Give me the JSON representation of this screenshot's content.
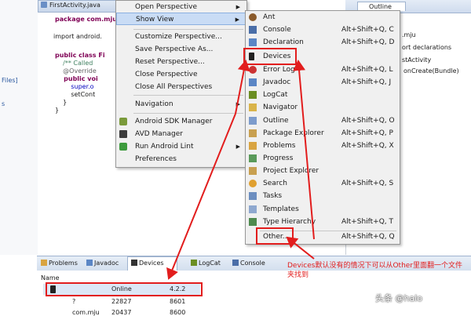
{
  "editor": {
    "tab_label": "FirstActivity.java",
    "code_lines": [
      "package com.mju",
      "import android.",
      "public class Fi",
      "    /** Called",
      "    @Override",
      "    public voi",
      "        super.o",
      "        setCont",
      "    }",
      "}"
    ]
  },
  "left_strip": {
    "labels": [
      "Files]",
      "s"
    ]
  },
  "outline": {
    "tab_label": "Outline",
    "items": [
      ".mju",
      "ort declarations",
      "stActivity",
      "onCreate(Bundle)"
    ]
  },
  "window_menu": {
    "items": [
      {
        "label": "Open Perspective",
        "submenu": true
      },
      {
        "label": "Show View",
        "submenu": true,
        "highlighted": true
      },
      {
        "label": "Customize Perspective..."
      },
      {
        "label": "Save Perspective As..."
      },
      {
        "label": "Reset Perspective..."
      },
      {
        "label": "Close Perspective"
      },
      {
        "label": "Close All Perspectives"
      },
      {
        "label": "Navigation",
        "submenu": true
      },
      {
        "label": "Android SDK Manager"
      },
      {
        "label": "AVD Manager"
      },
      {
        "label": "Run Android Lint",
        "submenu": true
      },
      {
        "label": "Preferences"
      }
    ]
  },
  "show_view_menu": {
    "items": [
      {
        "label": "Ant",
        "shortcut": ""
      },
      {
        "label": "Console",
        "shortcut": "Alt+Shift+Q, C"
      },
      {
        "label": "Declaration",
        "shortcut": "Alt+Shift+Q, D"
      },
      {
        "label": "Devices",
        "shortcut": ""
      },
      {
        "label": "Error Log",
        "shortcut": "Alt+Shift+Q, L"
      },
      {
        "label": "Javadoc",
        "shortcut": "Alt+Shift+Q, J"
      },
      {
        "label": "LogCat",
        "shortcut": ""
      },
      {
        "label": "Navigator",
        "shortcut": ""
      },
      {
        "label": "Outline",
        "shortcut": "Alt+Shift+Q, O"
      },
      {
        "label": "Package Explorer",
        "shortcut": "Alt+Shift+Q, P"
      },
      {
        "label": "Problems",
        "shortcut": "Alt+Shift+Q, X"
      },
      {
        "label": "Progress",
        "shortcut": ""
      },
      {
        "label": "Project Explorer",
        "shortcut": ""
      },
      {
        "label": "Search",
        "shortcut": "Alt+Shift+Q, S"
      },
      {
        "label": "Tasks",
        "shortcut": ""
      },
      {
        "label": "Templates",
        "shortcut": ""
      },
      {
        "label": "Type Hierarchy",
        "shortcut": "Alt+Shift+Q, T"
      },
      {
        "label": "Other...",
        "shortcut": "Alt+Shift+Q, Q"
      }
    ]
  },
  "bottom_views": {
    "tabs": [
      "Problems",
      "Javadoc",
      "Devices",
      "LogCat",
      "Console"
    ],
    "column_header": "Name",
    "rows": [
      {
        "name": "",
        "status": "Online",
        "version": "4.2.2"
      },
      {
        "name": "?",
        "status": "22827",
        "version": "8601"
      },
      {
        "name": "com.mju",
        "status": "20437",
        "version": "8600"
      }
    ]
  },
  "annotation": {
    "note": "Devices默认没有的情况下可以从Other里面翻一个文件夹找到",
    "color": "#e21d1d"
  },
  "watermark": "头条 @halo"
}
